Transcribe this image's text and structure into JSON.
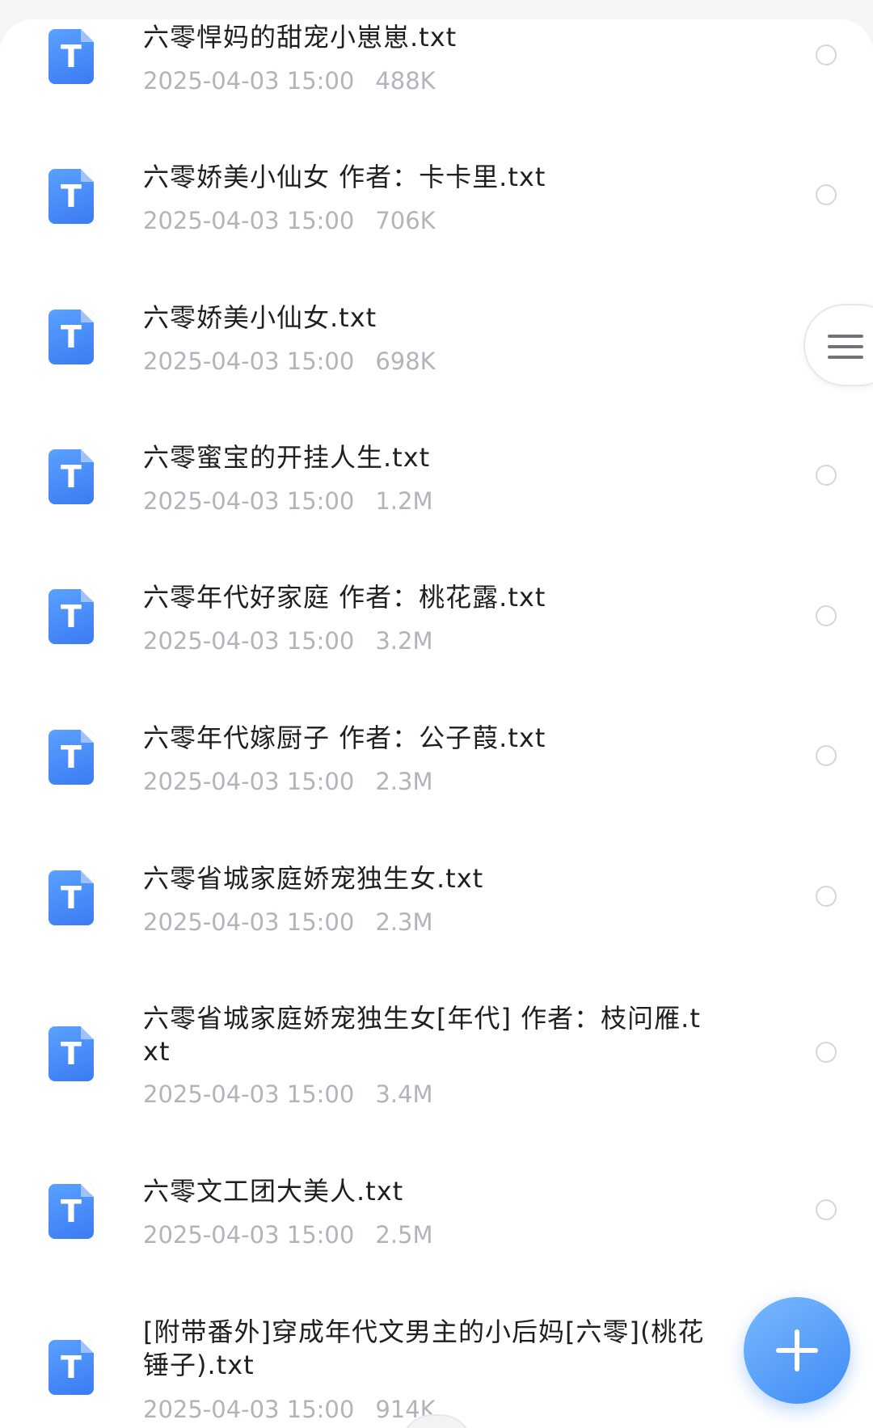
{
  "files": [
    {
      "name": "六零悍妈的甜宠小崽崽.txt",
      "date": "2025-04-03 15:00",
      "size": "488K",
      "icon": "txt-file-icon",
      "icon_letter": "T"
    },
    {
      "name": "六零娇美小仙女 作者：卡卡里.txt",
      "date": "2025-04-03 15:00",
      "size": "706K",
      "icon": "txt-file-icon",
      "icon_letter": "T"
    },
    {
      "name": "六零娇美小仙女.txt",
      "date": "2025-04-03 15:00",
      "size": "698K",
      "icon": "txt-file-icon",
      "icon_letter": "T"
    },
    {
      "name": "六零蜜宝的开挂人生.txt",
      "date": "2025-04-03 15:00",
      "size": "1.2M",
      "icon": "txt-file-icon",
      "icon_letter": "T"
    },
    {
      "name": "六零年代好家庭 作者：桃花露.txt",
      "date": "2025-04-03 15:00",
      "size": "3.2M",
      "icon": "txt-file-icon",
      "icon_letter": "T"
    },
    {
      "name": "六零年代嫁厨子 作者：公子葭.txt",
      "date": "2025-04-03 15:00",
      "size": "2.3M",
      "icon": "txt-file-icon",
      "icon_letter": "T"
    },
    {
      "name": "六零省城家庭娇宠独生女.txt",
      "date": "2025-04-03 15:00",
      "size": "2.3M",
      "icon": "txt-file-icon",
      "icon_letter": "T"
    },
    {
      "name": "六零省城家庭娇宠独生女[年代] 作者：枝问雁.txt",
      "date": "2025-04-03 15:00",
      "size": "3.4M",
      "icon": "txt-file-icon",
      "icon_letter": "T"
    },
    {
      "name": "六零文工团大美人.txt",
      "date": "2025-04-03 15:00",
      "size": "2.5M",
      "icon": "txt-file-icon",
      "icon_letter": "T"
    },
    {
      "name": "[附带番外]穿成年代文男主的小后妈[六零](桃花锤子).txt",
      "date": "2025-04-03 15:00",
      "size": "914K",
      "icon": "txt-file-icon",
      "icon_letter": "T"
    }
  ],
  "side_menu": {
    "icon": "menu-icon"
  },
  "fab": {
    "icon": "plus-icon"
  },
  "colors": {
    "icon_blue": "#3b7bf2",
    "fab_blue": "#4a94f7",
    "title_text": "#1f1f1f",
    "meta_text": "#b1b4ba",
    "radio_border": "#d4d6da"
  }
}
